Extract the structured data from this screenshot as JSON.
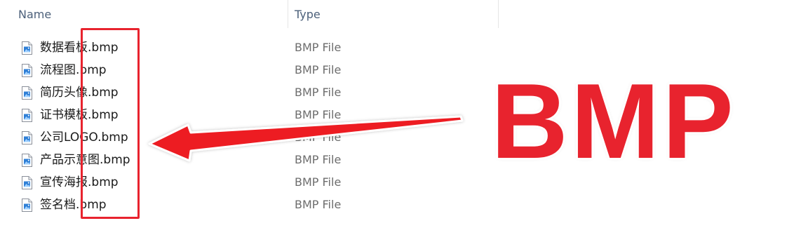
{
  "header": {
    "name_label": "Name",
    "type_label": "Type"
  },
  "files": [
    {
      "name": "数据看板.bmp",
      "type": "BMP File",
      "icon": "bmp-file-icon"
    },
    {
      "name": "流程图.bmp",
      "type": "BMP File",
      "icon": "bmp-file-icon"
    },
    {
      "name": "简历头像.bmp",
      "type": "BMP File",
      "icon": "bmp-file-icon"
    },
    {
      "name": "证书模板.bmp",
      "type": "BMP File",
      "icon": "bmp-file-icon"
    },
    {
      "name": "公司LOGO.bmp",
      "type": "BMP File",
      "icon": "bmp-file-icon"
    },
    {
      "name": "产品示意图.bmp",
      "type": "BMP File",
      "icon": "bmp-file-icon"
    },
    {
      "name": "宣传海报.bmp",
      "type": "BMP File",
      "icon": "bmp-file-icon"
    },
    {
      "name": "签名档.bmp",
      "type": "BMP File",
      "icon": "bmp-file-icon"
    }
  ],
  "annotation": {
    "label": "BMP",
    "color": "#e8232e"
  }
}
